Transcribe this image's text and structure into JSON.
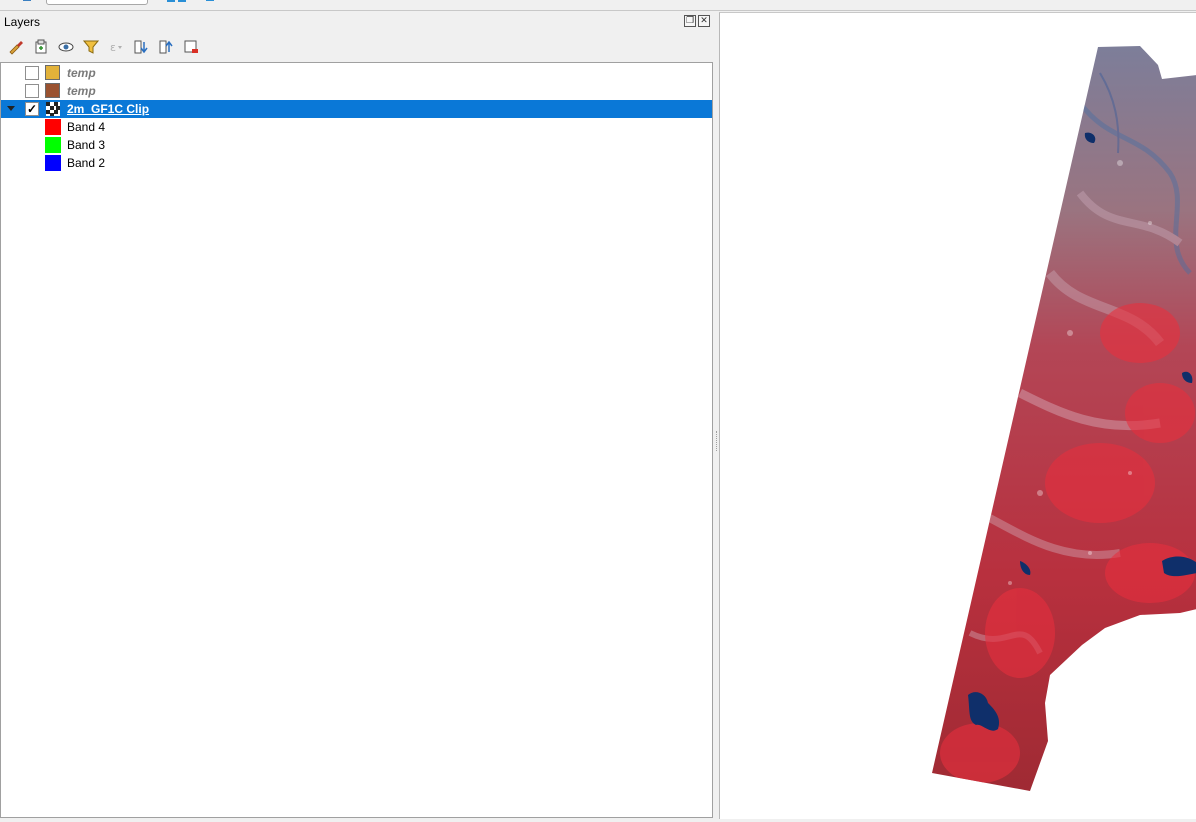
{
  "panel": {
    "title": "Layers"
  },
  "toolbar": {
    "buttons": [
      {
        "name": "open-layer-styling-icon"
      },
      {
        "name": "add-group-icon"
      },
      {
        "name": "manage-map-themes-icon"
      },
      {
        "name": "filter-legend-icon"
      },
      {
        "name": "filter-by-expression-icon"
      },
      {
        "name": "expand-all-icon"
      },
      {
        "name": "collapse-all-icon"
      },
      {
        "name": "remove-layer-icon"
      }
    ]
  },
  "layers": [
    {
      "label": "temp",
      "checked": false,
      "color": "#e2b23a"
    },
    {
      "label": "temp",
      "checked": false,
      "color": "#9a5230"
    },
    {
      "label": "2m_GF1C Clip",
      "checked": true,
      "selected": true,
      "expanded": true
    }
  ],
  "bands": [
    {
      "label": "Band 4",
      "color": "#ff0000"
    },
    {
      "label": "Band 3",
      "color": "#00ff00"
    },
    {
      "label": "Band 2",
      "color": "#0000ff"
    }
  ]
}
